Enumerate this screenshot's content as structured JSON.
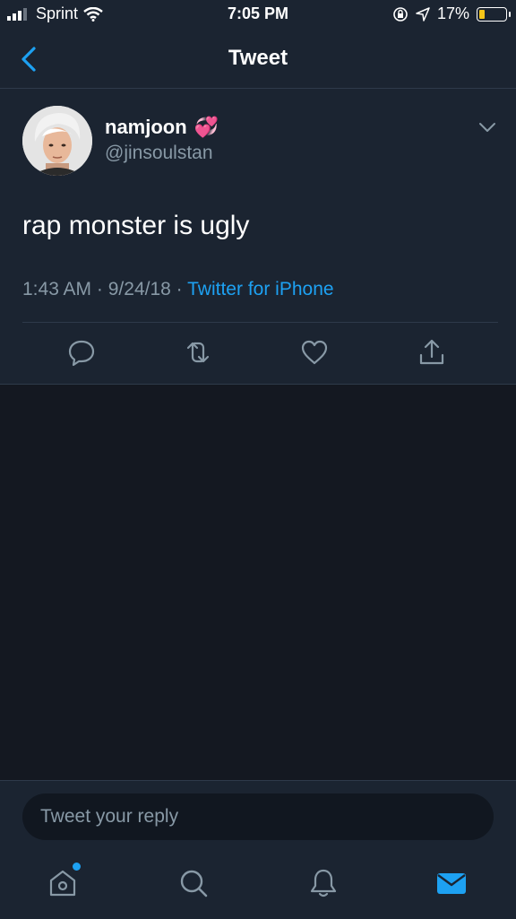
{
  "status_bar": {
    "carrier": "Sprint",
    "time": "7:05 PM",
    "battery": "17%",
    "battery_level": 0.17
  },
  "nav": {
    "title": "Tweet",
    "back_icon": "chevron-left-icon"
  },
  "tweet": {
    "author_name": "namjoon",
    "name_emoji": "💞",
    "handle": "@jinsoulstan",
    "text": "rap monster is ugly",
    "time": "1:43 AM",
    "date": "9/24/18",
    "separator": "·",
    "source": "Twitter for iPhone",
    "actions": [
      "reply-icon",
      "retweet-icon",
      "like-icon",
      "share-icon"
    ]
  },
  "reply_bar": {
    "placeholder": "Tweet your reply"
  },
  "tab_bar": {
    "items": [
      "home-icon",
      "search-icon",
      "notifications-icon",
      "messages-icon"
    ],
    "active": "messages-icon"
  },
  "colors": {
    "accent": "#1da1f2",
    "background": "#141821",
    "surface": "#1b2431",
    "muted_text": "#8899a6"
  }
}
